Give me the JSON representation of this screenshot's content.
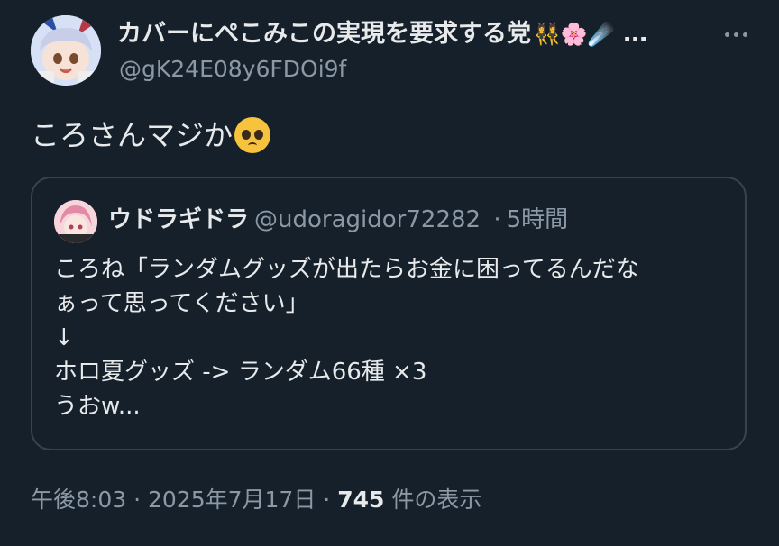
{
  "author": {
    "display_name": "カバーにぺこみこの実現を要求する党",
    "name_emojis": "👯‍♀️🌸☄️",
    "ellipsis": "…",
    "handle": "@gK24E08y6FDOi9f"
  },
  "tweet": {
    "text": "ころさんマジか",
    "emoji": "pleading-face"
  },
  "quote": {
    "name": "ウドラギドラ",
    "handle": "@udoragidor72282",
    "separator": "·",
    "time": "5時間",
    "lines": [
      "ころね「ランダムグッズが出たらお金に困ってるんだな",
      "ぁって思ってください」",
      "↓",
      "ホロ夏グッズ  -> ランダム66種 ×3",
      "うおw..."
    ]
  },
  "footer": {
    "time": "午後8:03",
    "sep1": "·",
    "date": "2025年7月17日",
    "sep2": "·",
    "views_count": "745",
    "views_label": "件の表示"
  },
  "colors": {
    "background": "#15202b",
    "text": "#e7e9ea",
    "secondary": "#8b98a5",
    "border": "#38444d"
  }
}
